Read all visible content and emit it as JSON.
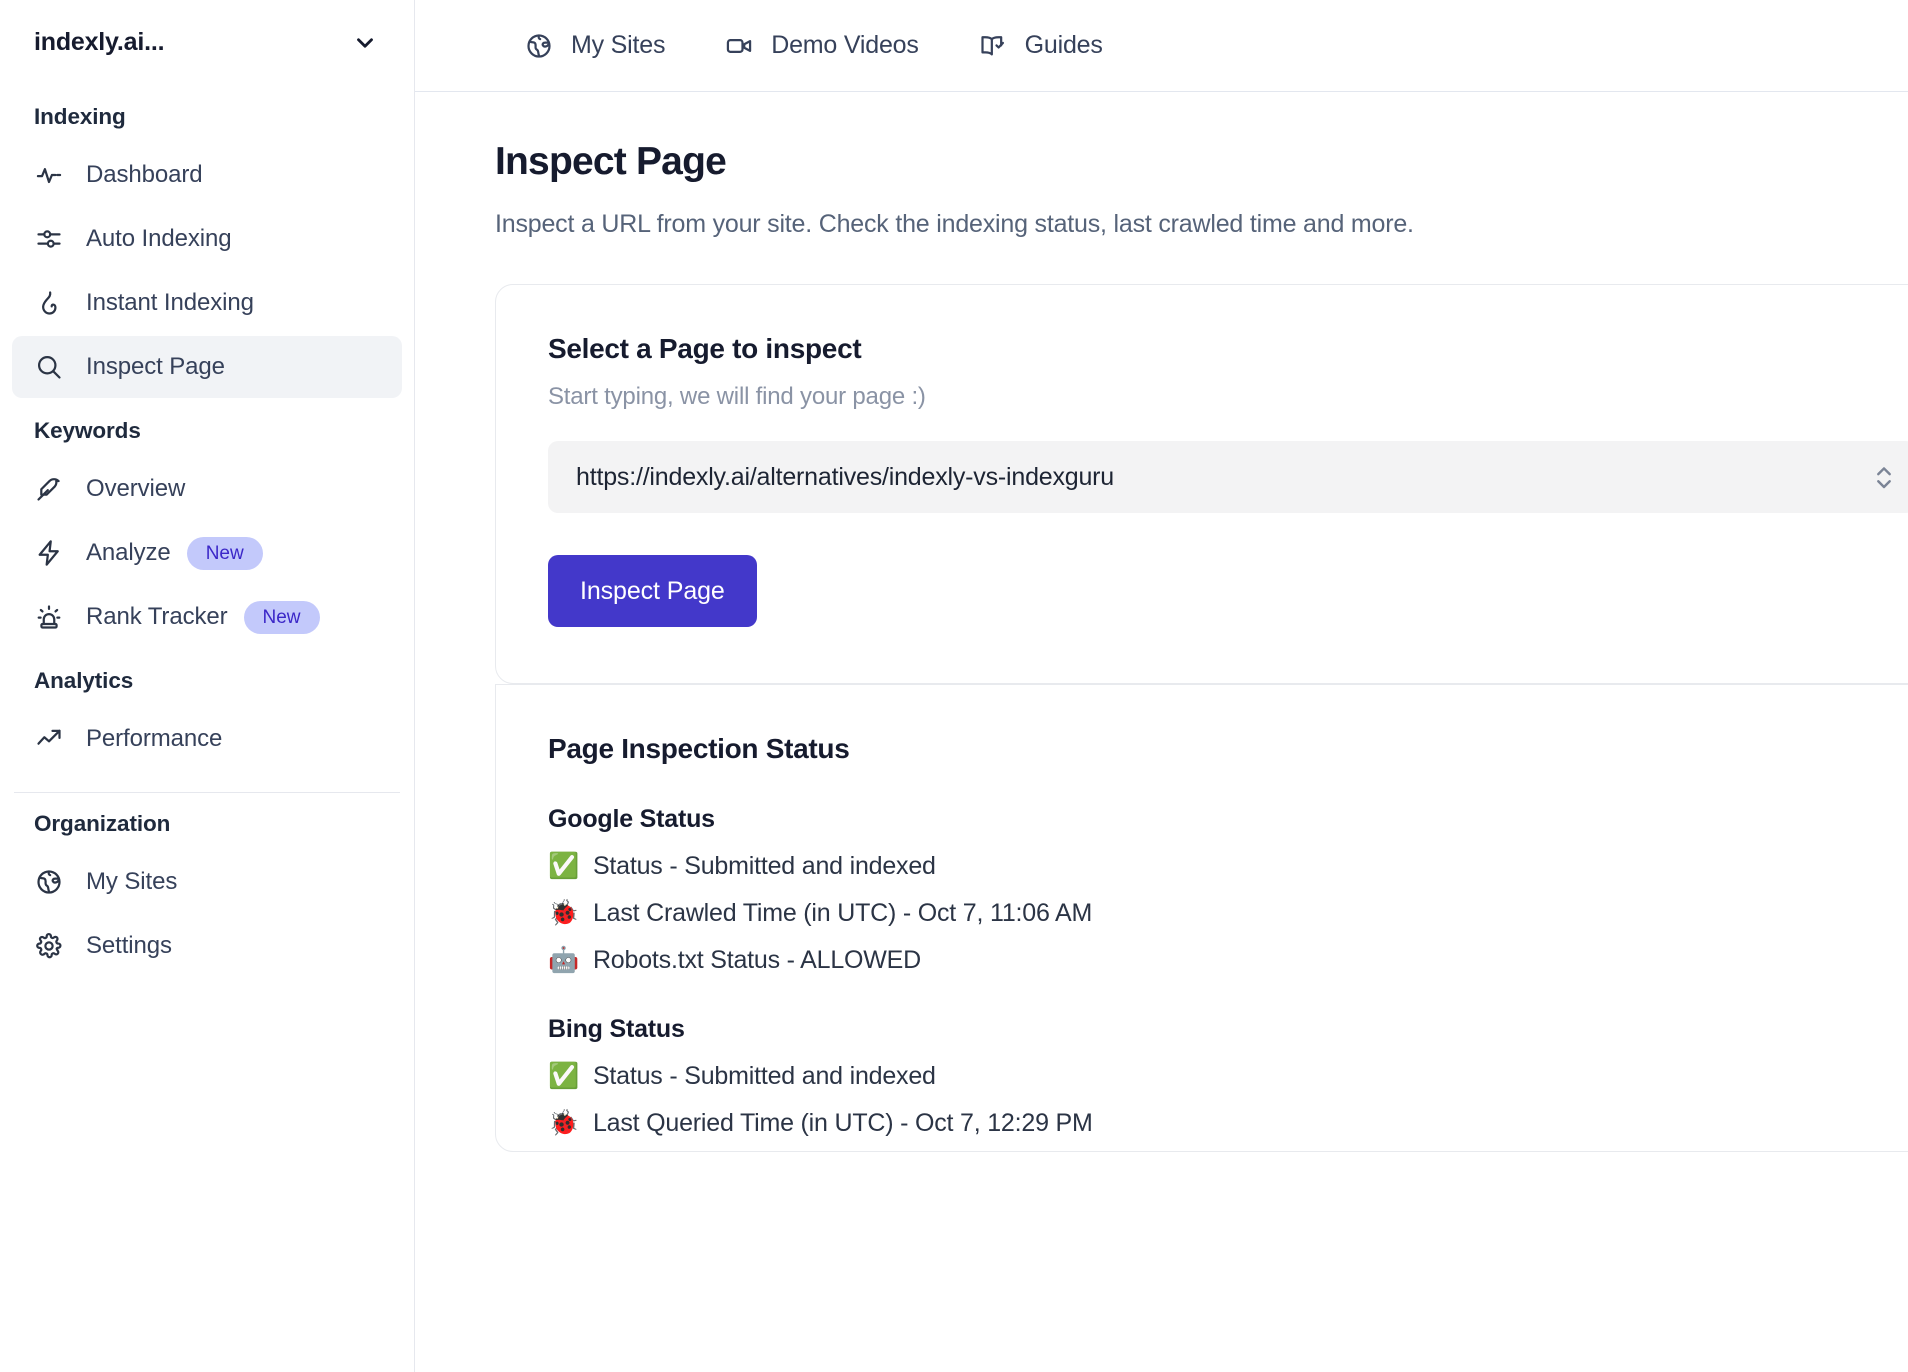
{
  "sidebar": {
    "site_switcher": {
      "label": "indexly.ai...",
      "icon": "chevron-down-icon"
    },
    "groups": [
      {
        "title": "Indexing",
        "items": [
          {
            "label": "Dashboard",
            "icon": "activity-icon",
            "active": false,
            "badge": null
          },
          {
            "label": "Auto Indexing",
            "icon": "sliders-icon",
            "active": false,
            "badge": null
          },
          {
            "label": "Instant Indexing",
            "icon": "flame-icon",
            "active": false,
            "badge": null
          },
          {
            "label": "Inspect Page",
            "icon": "search-icon",
            "active": true,
            "badge": null
          }
        ]
      },
      {
        "title": "Keywords",
        "items": [
          {
            "label": "Overview",
            "icon": "feather-icon",
            "active": false,
            "badge": null
          },
          {
            "label": "Analyze",
            "icon": "lightning-icon",
            "active": false,
            "badge": "New"
          },
          {
            "label": "Rank Tracker",
            "icon": "siren-icon",
            "active": false,
            "badge": "New"
          }
        ]
      },
      {
        "title": "Analytics",
        "items": [
          {
            "label": "Performance",
            "icon": "trending-up-icon",
            "active": false,
            "badge": null
          }
        ]
      },
      {
        "title": "Organization",
        "items": [
          {
            "label": "My Sites",
            "icon": "globe-icon",
            "active": false,
            "badge": null
          },
          {
            "label": "Settings",
            "icon": "gear-icon",
            "active": false,
            "badge": null
          }
        ]
      }
    ]
  },
  "topbar": {
    "tabs": [
      {
        "label": "My Sites",
        "icon": "globe-icon"
      },
      {
        "label": "Demo Videos",
        "icon": "video-camera-icon"
      },
      {
        "label": "Guides",
        "icon": "book-check-icon"
      }
    ]
  },
  "main": {
    "title": "Inspect Page",
    "subtitle": "Inspect a URL from your site. Check the indexing status, last crawled time and more.",
    "selector_card": {
      "title": "Select a Page to inspect",
      "hint": "Start typing, we will find your page :)",
      "select_value": "https://indexly.ai/alternatives/indexly-vs-indexguru",
      "select_icon": "chevron-up-down-icon",
      "button_label": "Inspect Page"
    },
    "status_card": {
      "title": "Page Inspection Status",
      "engines": [
        {
          "name": "Google Status",
          "lines": [
            {
              "emoji": "✅",
              "icon": "check-mark-button-emoji",
              "text": "Status - Submitted and indexed"
            },
            {
              "emoji": "🐞",
              "icon": "lady-beetle-emoji",
              "text": "Last Crawled Time (in UTC) - Oct 7, 11:06 AM"
            },
            {
              "emoji": "🤖",
              "icon": "robot-emoji",
              "text": "Robots.txt Status - ALLOWED"
            }
          ]
        },
        {
          "name": "Bing Status",
          "lines": [
            {
              "emoji": "✅",
              "icon": "check-mark-button-emoji",
              "text": "Status - Submitted and indexed"
            },
            {
              "emoji": "🐞",
              "icon": "lady-beetle-emoji",
              "text": "Last Queried Time (in UTC) - Oct 7, 12:29 PM"
            }
          ]
        }
      ]
    }
  },
  "colors": {
    "accent": "#4338ca",
    "badge_bg": "#c3c9fb",
    "badge_text": "#3b27c8",
    "active_nav_bg": "#f1f3f6",
    "input_bg": "#f3f3f4",
    "text_primary": "#161b2e",
    "text_muted": "#8a93a5"
  }
}
